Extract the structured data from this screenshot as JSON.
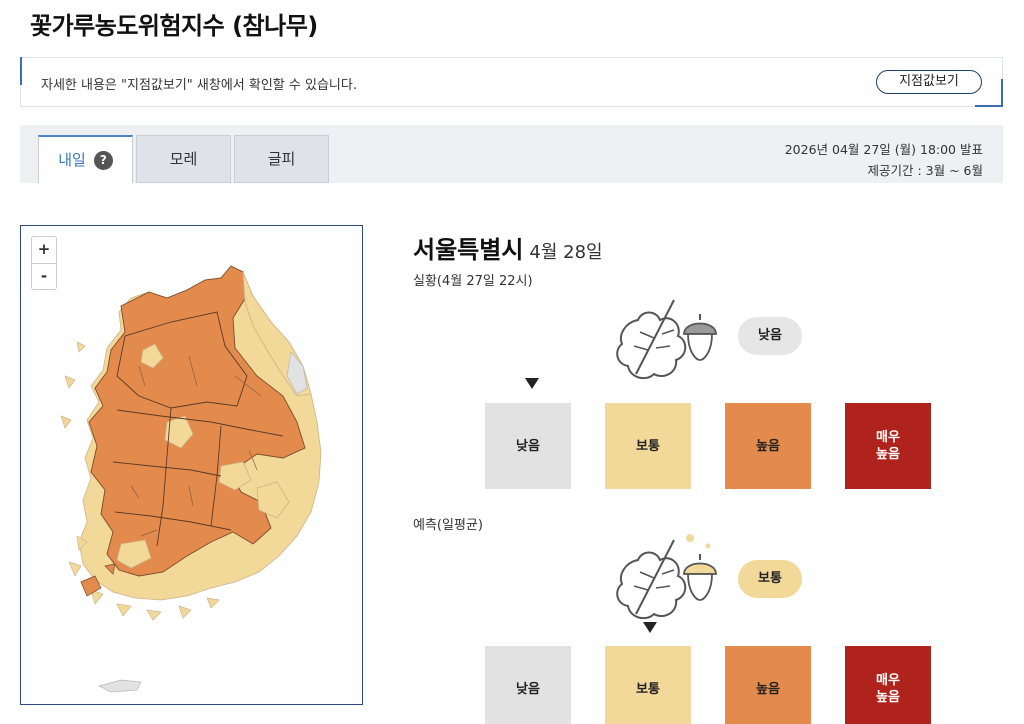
{
  "header": {
    "title": "꽃가루농도위험지수 (참나무)"
  },
  "notice": {
    "text": "자세한 내용은 \"지점값보기\" 새창에서 확인할 수 있습니다.",
    "button_label": "지점값보기"
  },
  "tabs": [
    {
      "label": "내일",
      "active": true
    },
    {
      "label": "모레",
      "active": false
    },
    {
      "label": "글피",
      "active": false
    }
  ],
  "help_symbol": "?",
  "issue": {
    "datetime": "2026년 04월 27일 (월) 18:00 발표",
    "period": "제공기간 : 3월 ~ 6월"
  },
  "map": {
    "zoom_in": "+",
    "zoom_out": "-",
    "colors": {
      "low": "#e2e2e2",
      "normal": "#f2d99a",
      "high": "#e38a4d",
      "very_high": "#b0231c"
    }
  },
  "region": {
    "name": "서울특별시",
    "date": "4월 28일"
  },
  "current": {
    "label": "실황(4월 27일 22시)",
    "badge": "낮음",
    "selected_level": "낮음",
    "icon": "oak-leaf-acorn-icon"
  },
  "forecast": {
    "label": "예측(일평균)",
    "badge": "보통",
    "selected_level": "보통",
    "icon": "oak-leaf-acorn-icon"
  },
  "levels": [
    {
      "line1": "낮음",
      "line2": ""
    },
    {
      "line1": "보통",
      "line2": ""
    },
    {
      "line1": "높음",
      "line2": ""
    },
    {
      "line1": "매우",
      "line2": "높음"
    }
  ]
}
